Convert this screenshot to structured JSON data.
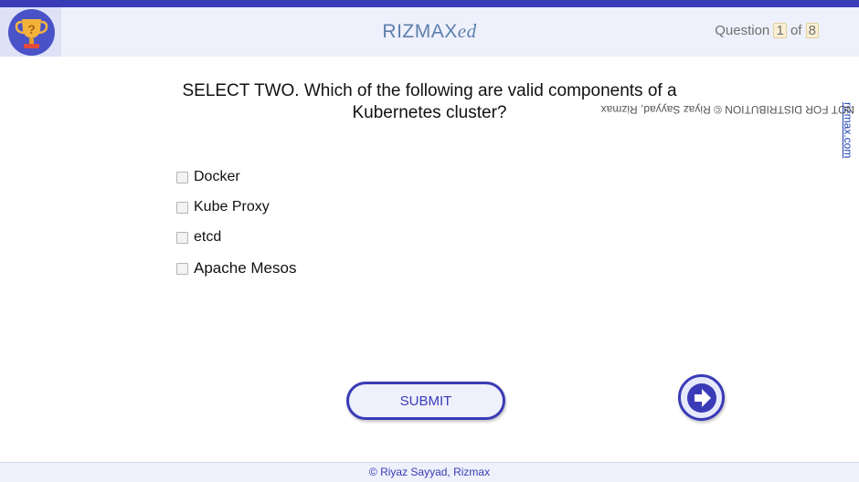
{
  "header": {
    "brand_main": "RIZMAX",
    "brand_suffix": "ed",
    "question_label": "Question",
    "question_current": "1",
    "question_of": "of",
    "question_total": "8"
  },
  "question": {
    "text": "SELECT TWO. Which of the following are valid components of a Kubernetes cluster?",
    "options": [
      {
        "label": "Docker",
        "checked": false
      },
      {
        "label": "Kube Proxy",
        "checked": false
      },
      {
        "label": "etcd",
        "checked": false
      },
      {
        "label": "Apache Mesos",
        "checked": false
      }
    ]
  },
  "actions": {
    "submit_label": "SUBMIT",
    "next_icon": "arrow-right-icon"
  },
  "watermark": {
    "text": "NOT FOR DISTRIBUTION © Riyaz Sayyad, Rizmax ",
    "link": "rizmax.com"
  },
  "footer": {
    "copyright": "© Riyaz Sayyad, Rizmax"
  },
  "colors": {
    "accent": "#3a3bb6",
    "header_bg": "#eef0fb",
    "brand": "#5d7fad",
    "trophy_gold": "#f2b33d"
  }
}
